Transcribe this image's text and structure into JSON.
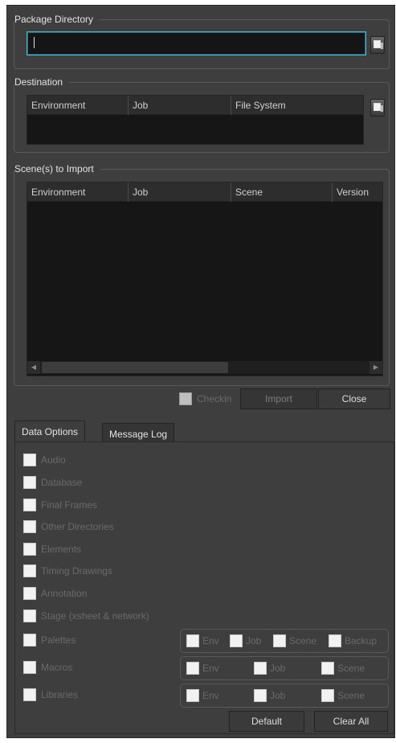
{
  "package_directory": {
    "title": "Package Directory",
    "value": ""
  },
  "destination": {
    "title": "Destination",
    "columns": [
      "Environment",
      "Job",
      "File System"
    ]
  },
  "scenes_to_import": {
    "title": "Scene(s) to Import",
    "columns": [
      "Environment",
      "Job",
      "Scene",
      "Version"
    ]
  },
  "actions": {
    "checkin_label": "Checkin",
    "import_label": "Import",
    "close_label": "Close"
  },
  "tabs": [
    {
      "label": "Data Options",
      "active": true
    },
    {
      "label": "Message Log",
      "active": false
    }
  ],
  "data_options": {
    "items": [
      {
        "label": "Audio"
      },
      {
        "label": "Database"
      },
      {
        "label": "Final Frames"
      },
      {
        "label": "Other Directories"
      },
      {
        "label": "Elements"
      },
      {
        "label": "Timing Drawings"
      },
      {
        "label": "Annotation"
      },
      {
        "label": "Stage (xsheet & network)"
      },
      {
        "label": "Palettes"
      },
      {
        "label": "Macros"
      },
      {
        "label": "Libraries"
      }
    ],
    "palettes_scope": [
      "Env",
      "Job",
      "Scene",
      "Backup"
    ],
    "macros_scope": [
      "Env",
      "Job",
      "Scene"
    ],
    "libraries_scope": [
      "Env",
      "Job",
      "Scene"
    ],
    "default_label": "Default",
    "clear_all_label": "Clear All"
  }
}
